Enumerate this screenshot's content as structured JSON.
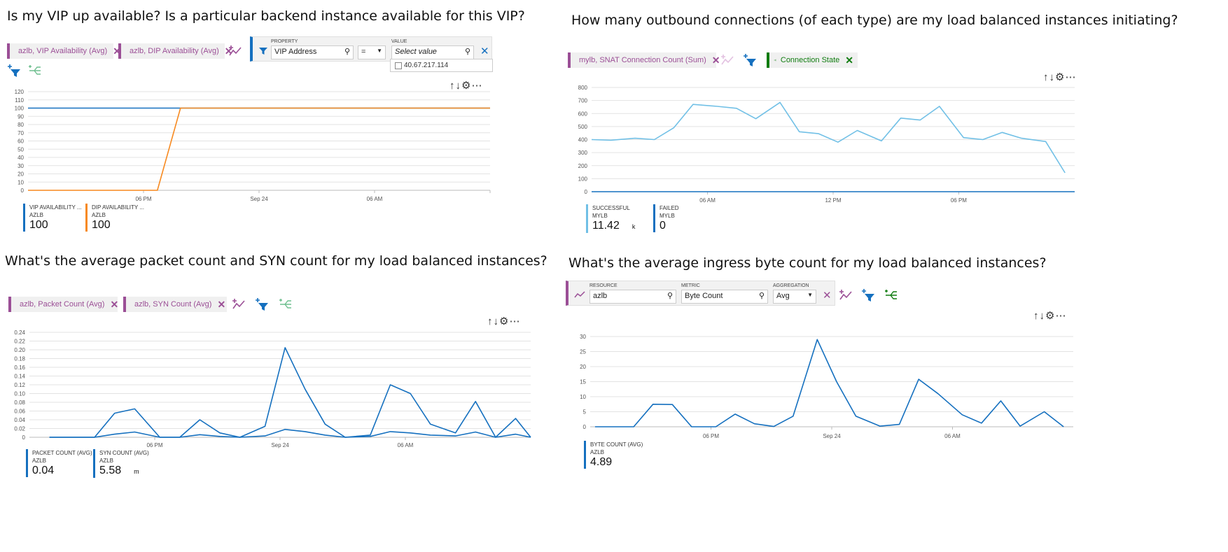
{
  "panels": {
    "p1": {
      "question": "Is my VIP up available? Is a particular backend instance available for this VIP?",
      "pills": [
        "azlb, VIP Availability (Avg)",
        "azlb, DIP Availability (Avg)"
      ],
      "filter": {
        "property_label": "PROPERTY",
        "property_value": "VIP Address",
        "operator": "=",
        "value_label": "VALUE",
        "value_placeholder": "Select value",
        "option": "40.67.217.114"
      },
      "legend": [
        {
          "name": "VIP AVAILABILITY ...",
          "resource": "AZLB",
          "value": "100",
          "color": "#1570bf"
        },
        {
          "name": "DIP AVAILABILITY ...",
          "resource": "AZLB",
          "value": "100",
          "color": "#f7891f"
        }
      ]
    },
    "p2": {
      "question": "How many outbound connections (of each type) are my load balanced instances initiating?",
      "pills": [
        "mylb, SNAT Connection Count (Sum)",
        "Connection State"
      ],
      "legend": [
        {
          "name": "SUCCESSFUL",
          "resource": "MYLB",
          "value": "11.42",
          "unit": "k",
          "color": "#71c0e6"
        },
        {
          "name": "FAILED",
          "resource": "MYLB",
          "value": "0",
          "color": "#1570bf"
        }
      ]
    },
    "p3": {
      "question": "What's the average packet count and SYN count for my load balanced instances?",
      "pills": [
        "azlb, Packet Count (Avg)",
        "azlb, SYN Count (Avg)"
      ],
      "legend": [
        {
          "name": "PACKET COUNT (AVG)",
          "resource": "AZLB",
          "value": "0.04",
          "color": "#1570bf"
        },
        {
          "name": "SYN COUNT (AVG)",
          "resource": "AZLB",
          "value": "5.58",
          "unit": "m",
          "color": "#1570bf"
        }
      ]
    },
    "p4": {
      "question": "What's the average ingress byte count for my load balanced instances?",
      "metric_editor": {
        "resource_label": "RESOURCE",
        "resource_value": "azlb",
        "metric_label": "METRIC",
        "metric_value": "Byte Count",
        "aggregation_label": "AGGREGATION",
        "aggregation_value": "Avg"
      },
      "legend": [
        {
          "name": "BYTE COUNT (AVG)",
          "resource": "AZLB",
          "value": "4.89",
          "color": "#1570bf"
        }
      ]
    }
  },
  "chart_data": [
    {
      "type": "line",
      "ylim": [
        0,
        120
      ],
      "yticks": [
        "120",
        "110",
        "100",
        "90",
        "80",
        "70",
        "60",
        "50",
        "40",
        "30",
        "20",
        "10",
        "0"
      ],
      "xticks": [
        "06 PM",
        "Sep 24",
        "06 AM"
      ],
      "xtick_pos": [
        0.25,
        0.5,
        0.75
      ],
      "series": [
        {
          "name": "VIP AVAILABILITY ...",
          "color": "#1570bf",
          "x": [
            0,
            0.33,
            1.0
          ],
          "y": [
            100,
            100,
            100
          ]
        },
        {
          "name": "DIP AVAILABILITY ...",
          "color": "#f7891f",
          "x": [
            0,
            0.28,
            0.33,
            1.0
          ],
          "y": [
            0,
            0,
            100,
            100
          ]
        }
      ]
    },
    {
      "type": "line",
      "ylim": [
        0,
        800
      ],
      "yticks": [
        "800",
        "700",
        "600",
        "500",
        "400",
        "300",
        "200",
        "100",
        "0"
      ],
      "xticks": [
        "06 AM",
        "12 PM",
        "06 PM"
      ],
      "xtick_pos": [
        0.24,
        0.5,
        0.76
      ],
      "series": [
        {
          "name": "SUCCESSFUL",
          "color": "#71c0e6",
          "x": [
            0,
            0.04,
            0.09,
            0.13,
            0.17,
            0.21,
            0.26,
            0.3,
            0.34,
            0.39,
            0.43,
            0.47,
            0.51,
            0.55,
            0.6,
            0.64,
            0.68,
            0.72,
            0.77,
            0.81,
            0.85,
            0.89,
            0.94,
            0.98
          ],
          "y": [
            400,
            395,
            410,
            400,
            490,
            670,
            655,
            640,
            560,
            685,
            460,
            445,
            380,
            470,
            390,
            565,
            550,
            655,
            415,
            400,
            455,
            410,
            385,
            145
          ]
        },
        {
          "name": "FAILED",
          "color": "#1570bf",
          "x": [
            0,
            1.0
          ],
          "y": [
            0,
            0
          ]
        }
      ]
    },
    {
      "type": "line",
      "ylim": [
        0,
        0.24
      ],
      "yticks": [
        "0.24",
        "0.22",
        "0.20",
        "0.18",
        "0.16",
        "0.14",
        "0.12",
        "0.10",
        "0.08",
        "0.06",
        "0.04",
        "0.02",
        "0"
      ],
      "xticks": [
        "06 PM",
        "Sep 24",
        "06 AM"
      ],
      "xtick_pos": [
        0.25,
        0.5,
        0.75
      ],
      "series": [
        {
          "name": "PACKET COUNT (AVG)",
          "color": "#1570bf",
          "x": [
            0.04,
            0.09,
            0.13,
            0.17,
            0.21,
            0.26,
            0.3,
            0.34,
            0.38,
            0.42,
            0.47,
            0.51,
            0.55,
            0.59,
            0.63,
            0.68,
            0.72,
            0.76,
            0.8,
            0.85,
            0.89,
            0.93,
            0.97,
            1.0
          ],
          "y": [
            0,
            0,
            0,
            0.055,
            0.065,
            0,
            0,
            0.04,
            0.01,
            0,
            0.025,
            0.205,
            0.11,
            0.03,
            0,
            0.005,
            0.12,
            0.1,
            0.03,
            0.01,
            0.082,
            0,
            0.043,
            0
          ]
        },
        {
          "name": "SYN COUNT (AVG)",
          "color": "#1570bf",
          "x": [
            0.04,
            0.09,
            0.13,
            0.17,
            0.21,
            0.26,
            0.3,
            0.34,
            0.38,
            0.42,
            0.47,
            0.51,
            0.55,
            0.59,
            0.63,
            0.68,
            0.72,
            0.76,
            0.8,
            0.85,
            0.89,
            0.93,
            0.97,
            1.0
          ],
          "y": [
            0,
            0,
            0,
            0.007,
            0.012,
            0,
            0,
            0.006,
            0.002,
            0,
            0.003,
            0.018,
            0.013,
            0.005,
            0,
            0.002,
            0.013,
            0.01,
            0.005,
            0.003,
            0.012,
            0,
            0.007,
            0
          ]
        }
      ]
    },
    {
      "type": "line",
      "ylim": [
        0,
        30
      ],
      "yticks": [
        "30",
        "25",
        "20",
        "15",
        "10",
        "5",
        "0"
      ],
      "xticks": [
        "06 PM",
        "Sep 24",
        "06 AM"
      ],
      "xtick_pos": [
        0.25,
        0.5,
        0.75
      ],
      "series": [
        {
          "name": "BYTE COUNT (AVG)",
          "color": "#1570bf",
          "x": [
            0.01,
            0.05,
            0.09,
            0.13,
            0.17,
            0.21,
            0.26,
            0.3,
            0.34,
            0.38,
            0.42,
            0.47,
            0.51,
            0.55,
            0.6,
            0.64,
            0.68,
            0.72,
            0.77,
            0.81,
            0.85,
            0.89,
            0.94,
            0.98
          ],
          "y": [
            0,
            0,
            0,
            7.5,
            7.4,
            0,
            0,
            4.2,
            1,
            0.1,
            3.5,
            29,
            15,
            3.5,
            0.2,
            0.8,
            15.8,
            11,
            4,
            1.2,
            8.6,
            0.2,
            5,
            0
          ]
        }
      ]
    }
  ]
}
